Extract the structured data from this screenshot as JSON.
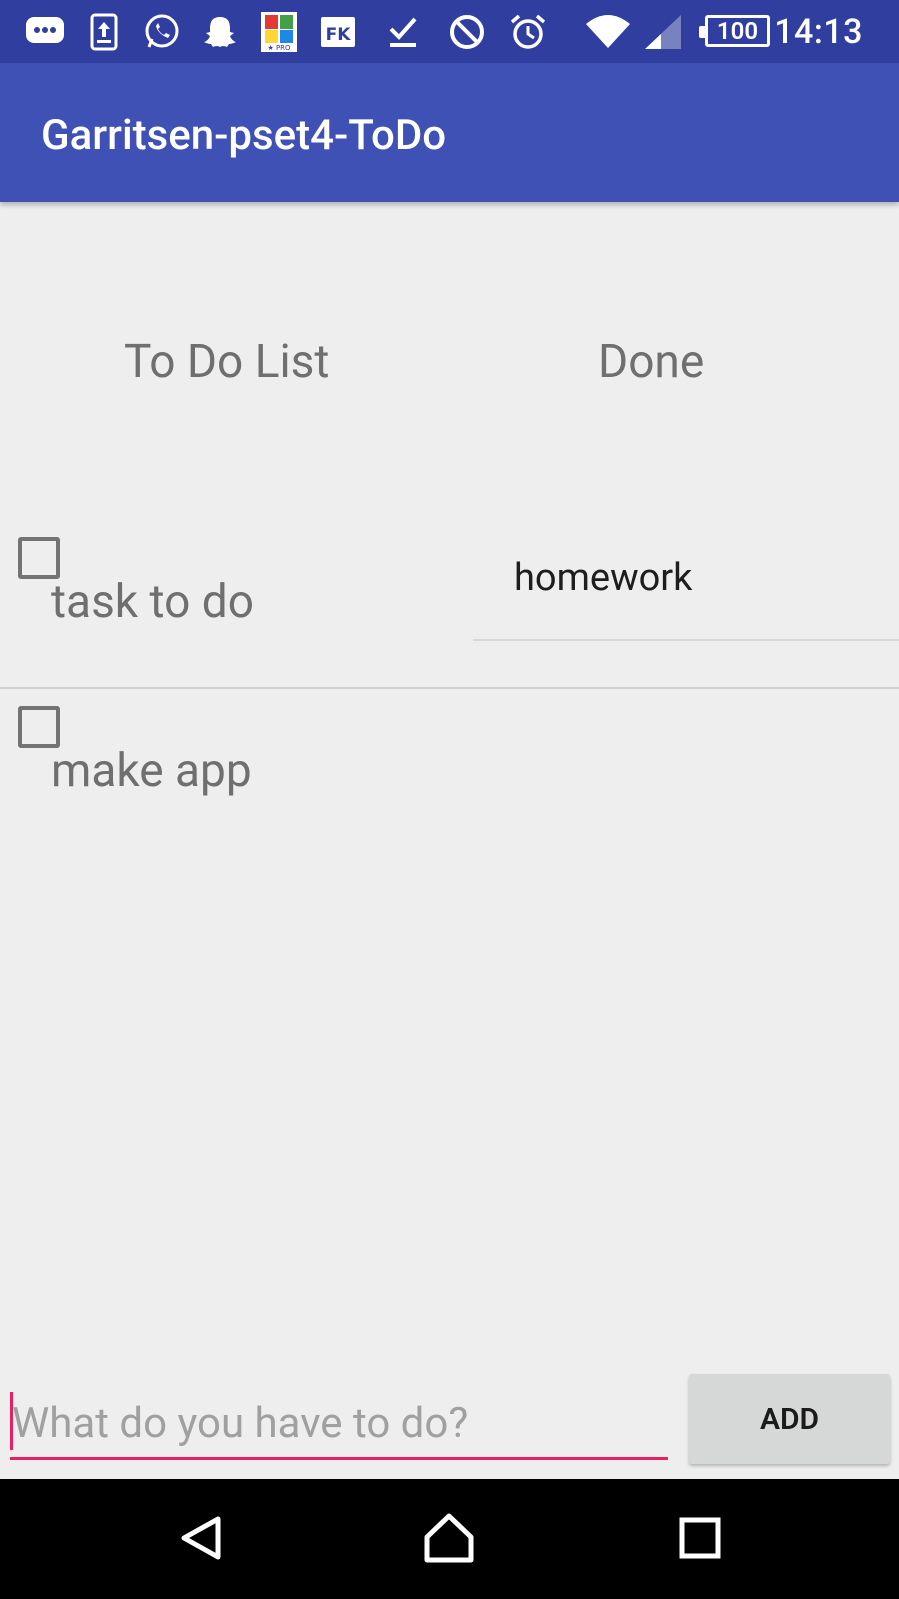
{
  "status_bar": {
    "time": "14:13",
    "battery": "100",
    "icons": [
      "messages-icon",
      "upload-icon",
      "whatsapp-icon",
      "snapchat-icon",
      "avg-pro-icon",
      "fk-icon",
      "download-done-icon",
      "do-not-disturb-icon",
      "alarm-icon",
      "wifi-icon",
      "signal-icon"
    ]
  },
  "app_bar": {
    "title": "Garritsen-pset4-ToDo"
  },
  "columns": {
    "todo_header": "To Do List",
    "done_header": "Done"
  },
  "todo_items": [
    {
      "label": "task to do",
      "checked": false
    },
    {
      "label": "make app",
      "checked": false
    }
  ],
  "done_items": [
    {
      "label": "homework"
    }
  ],
  "input": {
    "placeholder": "What do you have to do?",
    "value": ""
  },
  "add_button": {
    "label": "ADD"
  },
  "colors": {
    "status_bar": "#303f9f",
    "app_bar": "#3f51b5",
    "accent": "#e91e63"
  }
}
